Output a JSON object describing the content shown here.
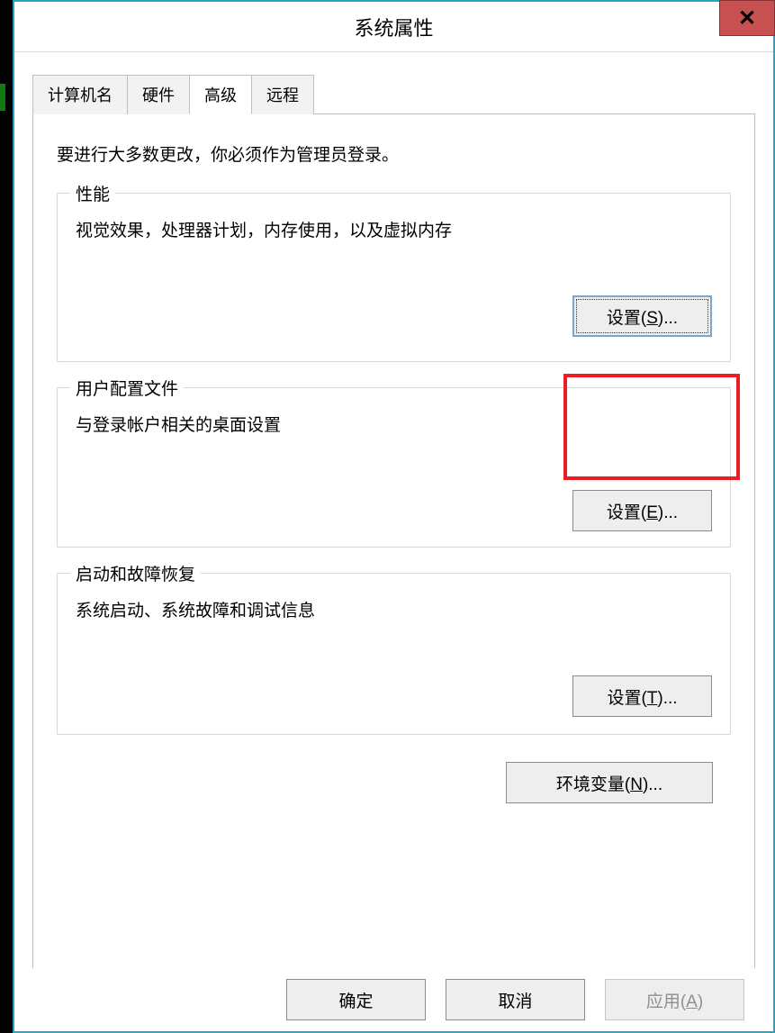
{
  "window": {
    "title": "系统属性"
  },
  "tabs": [
    "计算机名",
    "硬件",
    "高级",
    "远程"
  ],
  "intro": "要进行大多数更改，你必须作为管理员登录。",
  "groups": {
    "performance": {
      "title": "性能",
      "desc": "视觉效果，处理器计划，内存使用，以及虚拟内存",
      "btn_prefix": "设置",
      "hotkey": "S"
    },
    "userProfiles": {
      "title": "用户配置文件",
      "desc": "与登录帐户相关的桌面设置",
      "btn_prefix": "设置",
      "hotkey": "E"
    },
    "startupRecovery": {
      "title": "启动和故障恢复",
      "desc": "系统启动、系统故障和调试信息",
      "btn_prefix": "设置",
      "hotkey": "T"
    }
  },
  "envBtn": {
    "prefix": "环境变量",
    "hotkey": "N"
  },
  "footer": {
    "ok": "确定",
    "cancel": "取消",
    "apply_prefix": "应用",
    "apply_hotkey": "A"
  }
}
